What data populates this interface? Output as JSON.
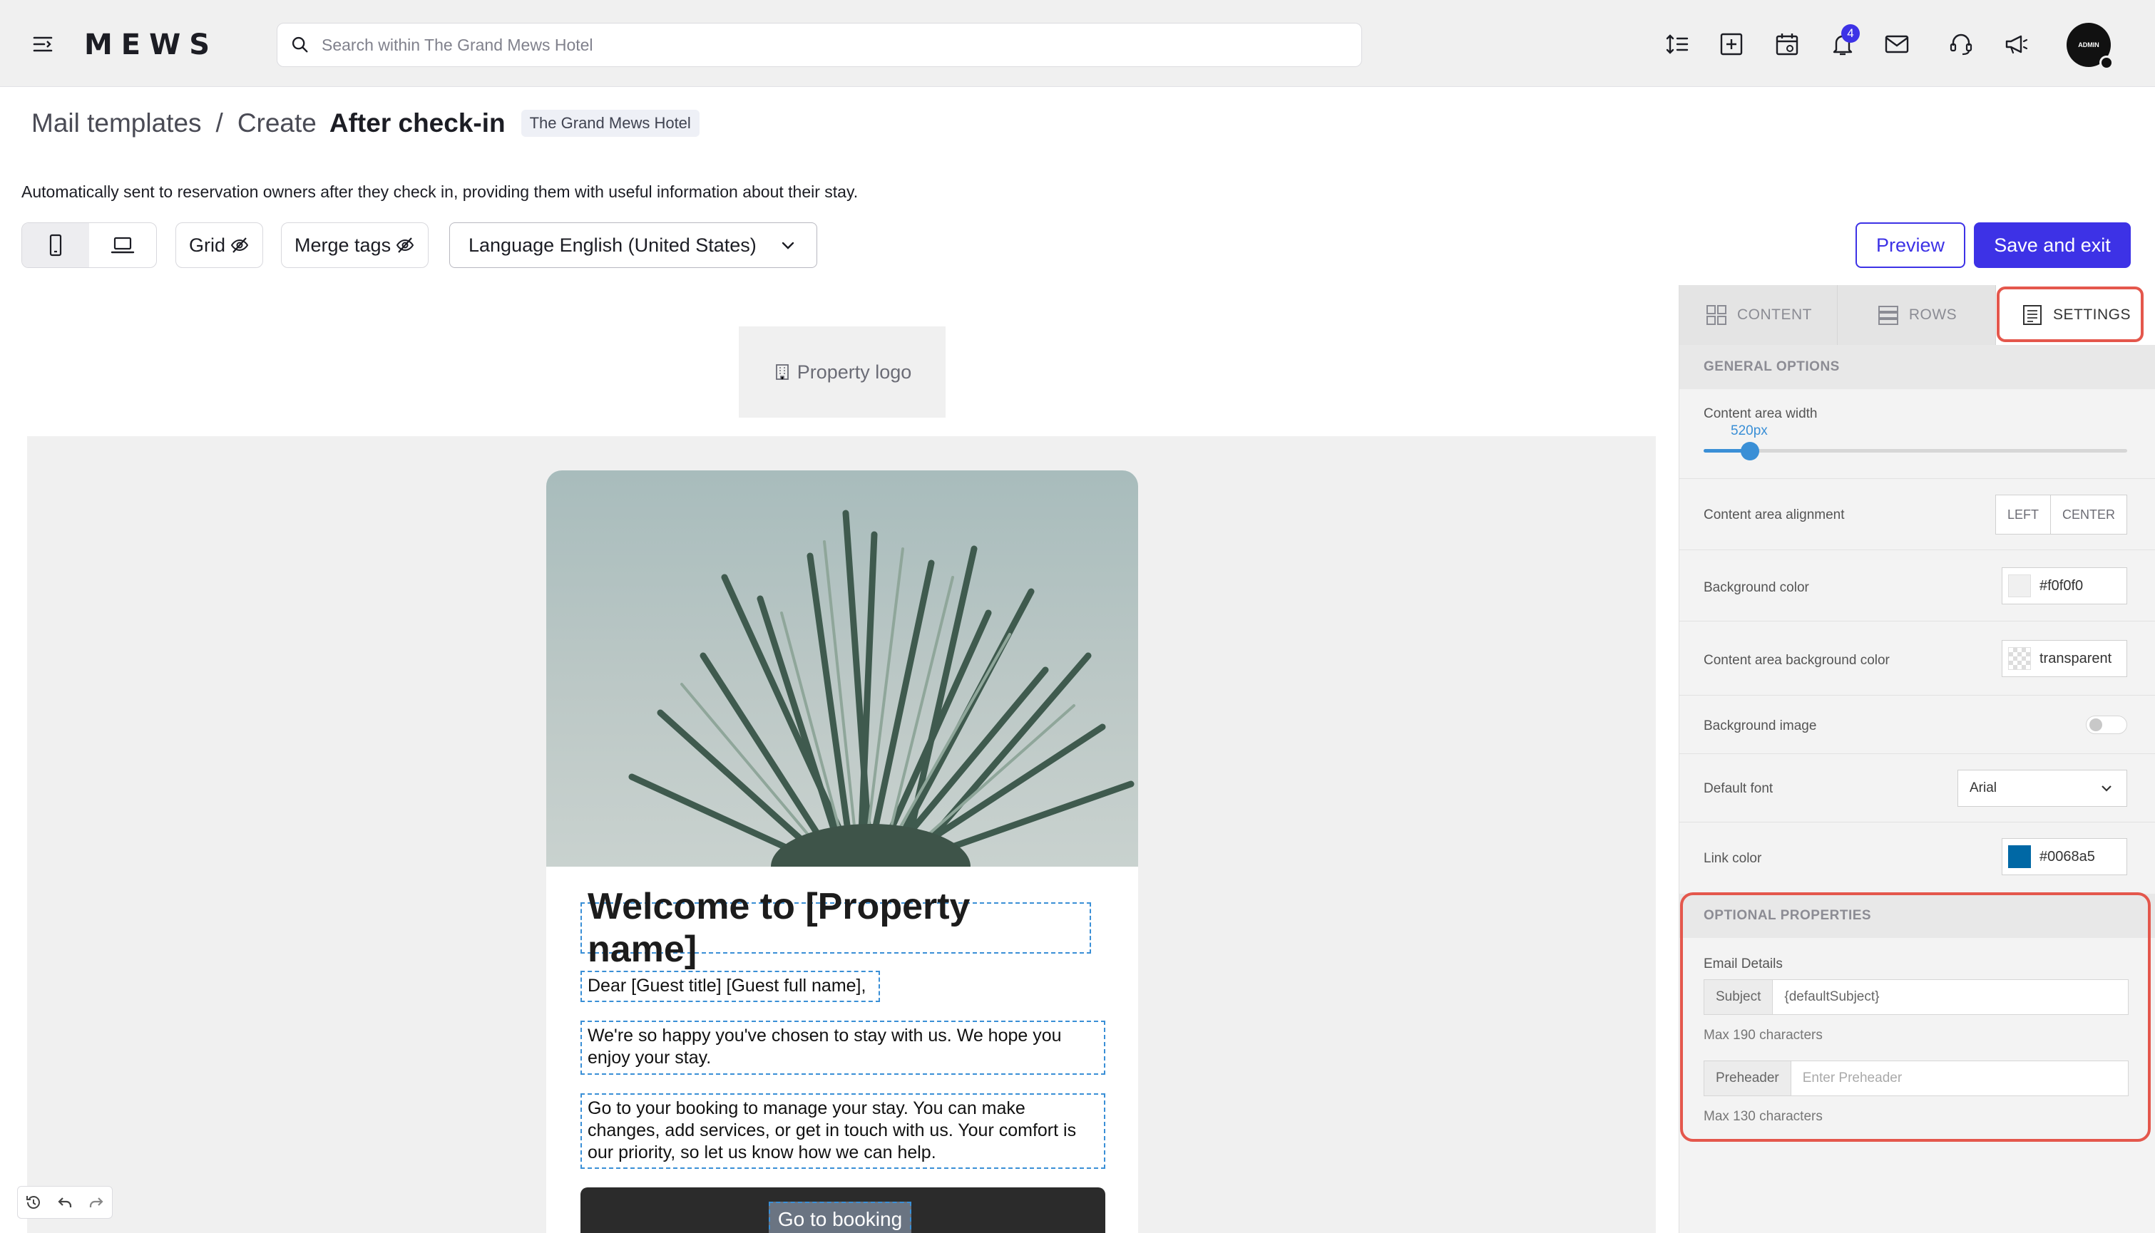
{
  "app": {
    "logo": "MEWS",
    "search_placeholder": "Search within The Grand Mews Hotel",
    "notification_count": "4",
    "avatar_label": "ADMIN"
  },
  "header": {
    "breadcrumb_root": "Mail templates",
    "breadcrumb_sep": "/",
    "breadcrumb_action": "Create",
    "breadcrumb_current": "After check-in",
    "property_chip": "The Grand Mews Hotel",
    "description": "Automatically sent to reservation owners after they check in, providing them with useful information about their stay."
  },
  "toolbar": {
    "grid_label": "Grid",
    "merge_tags_label": "Merge tags",
    "language_label": "Language English (United States)",
    "preview_label": "Preview",
    "save_label": "Save and exit"
  },
  "editor": {
    "property_logo": "Property logo",
    "welcome_heading": "Welcome to [Property name]",
    "greeting": "Dear [Guest title] [Guest full name],",
    "paragraph1": "We're so happy you've chosen to stay with us. We hope you enjoy your stay.",
    "paragraph2": "Go to your booking to manage your stay. You can make changes, add services, or get in touch with us. Your comfort is our priority, so let us know how we can help.",
    "cta_label": "Go to booking"
  },
  "panel": {
    "tabs": [
      {
        "label": "CONTENT",
        "icon": "content-grid-icon"
      },
      {
        "label": "ROWS",
        "icon": "rows-icon"
      },
      {
        "label": "SETTINGS",
        "icon": "settings-doc-icon",
        "active": true
      }
    ],
    "general_title": "GENERAL OPTIONS",
    "content_width_label": "Content area width",
    "content_width_value": "520px",
    "content_width_fraction": 0.11,
    "alignment_label": "Content area alignment",
    "alignment_options": [
      "LEFT",
      "CENTER"
    ],
    "bg_color_label": "Background color",
    "bg_color_value": "#f0f0f0",
    "content_bg_label": "Content area background color",
    "content_bg_value": "transparent",
    "bg_image_label": "Background image",
    "default_font_label": "Default font",
    "default_font_value": "Arial",
    "link_color_label": "Link color",
    "link_color_value": "#0068a5",
    "optional_title": "OPTIONAL PROPERTIES",
    "email_details_label": "Email Details",
    "subject_addon": "Subject",
    "subject_value": "{defaultSubject}",
    "subject_hint": "Max 190 characters",
    "preheader_addon": "Preheader",
    "preheader_placeholder": "Enter Preheader",
    "preheader_hint": "Max 130 characters"
  },
  "colors": {
    "accent": "#3d32e6",
    "highlight": "#e4574c",
    "selection": "#3a8fd6",
    "link": "#0068a5"
  }
}
